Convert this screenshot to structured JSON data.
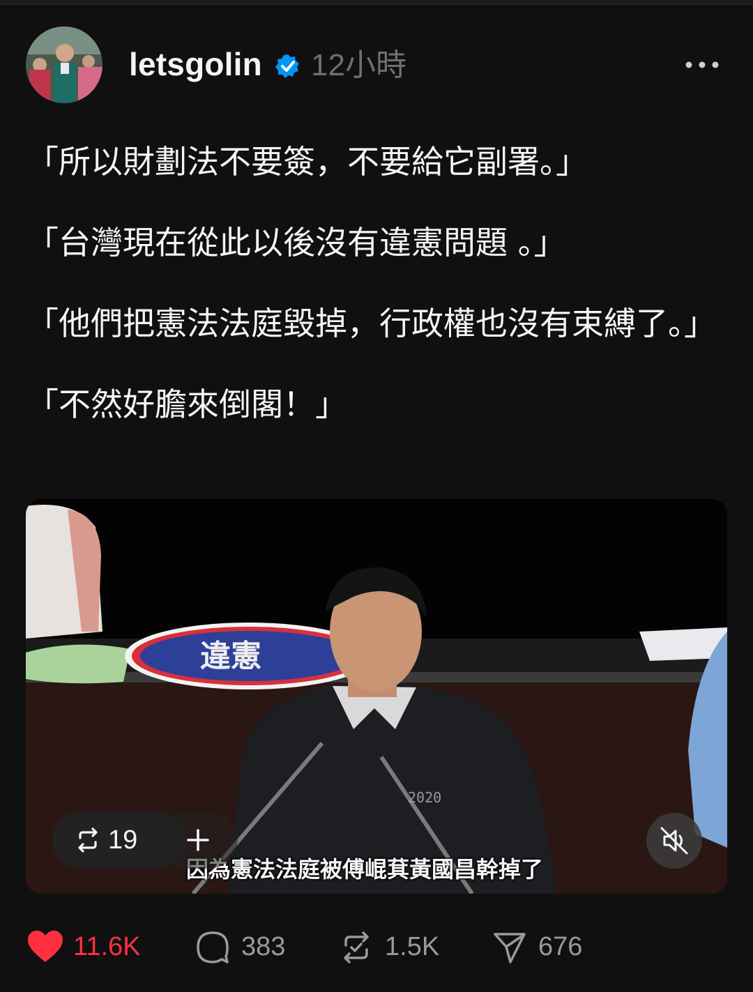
{
  "post": {
    "username": "letsgolin",
    "timestamp": "12小時",
    "paragraphs": [
      "「所以財劃法不要簽，不要給它副署。」",
      "「台灣現在從此以後沒有違憲問題 。」",
      "「他們把憲法法庭毀掉，行政權也沒有束縛了。」",
      "「不然好膽來倒閣！」"
    ]
  },
  "video": {
    "subtitle": "因為憲法法庭被傅崐萁黃國昌幹掉了",
    "repost_count": "19",
    "jacket_text": "2020",
    "placard_text": "違憲"
  },
  "actions": {
    "likes": "11.6K",
    "replies": "383",
    "reposts": "1.5K",
    "shares": "676"
  },
  "icons": {
    "verified": "verified-badge-icon",
    "more": "more-horizontal-icon",
    "like": "heart-icon",
    "reply": "comment-bubble-icon",
    "repost": "repost-icon",
    "share": "send-icon",
    "mute": "speaker-muted-icon",
    "add": "plus-icon"
  },
  "colors": {
    "background": "#101010",
    "text": "#f3f5f7",
    "muted": "#6f6f6f",
    "like": "#ff3040",
    "verified": "#0095f6"
  }
}
